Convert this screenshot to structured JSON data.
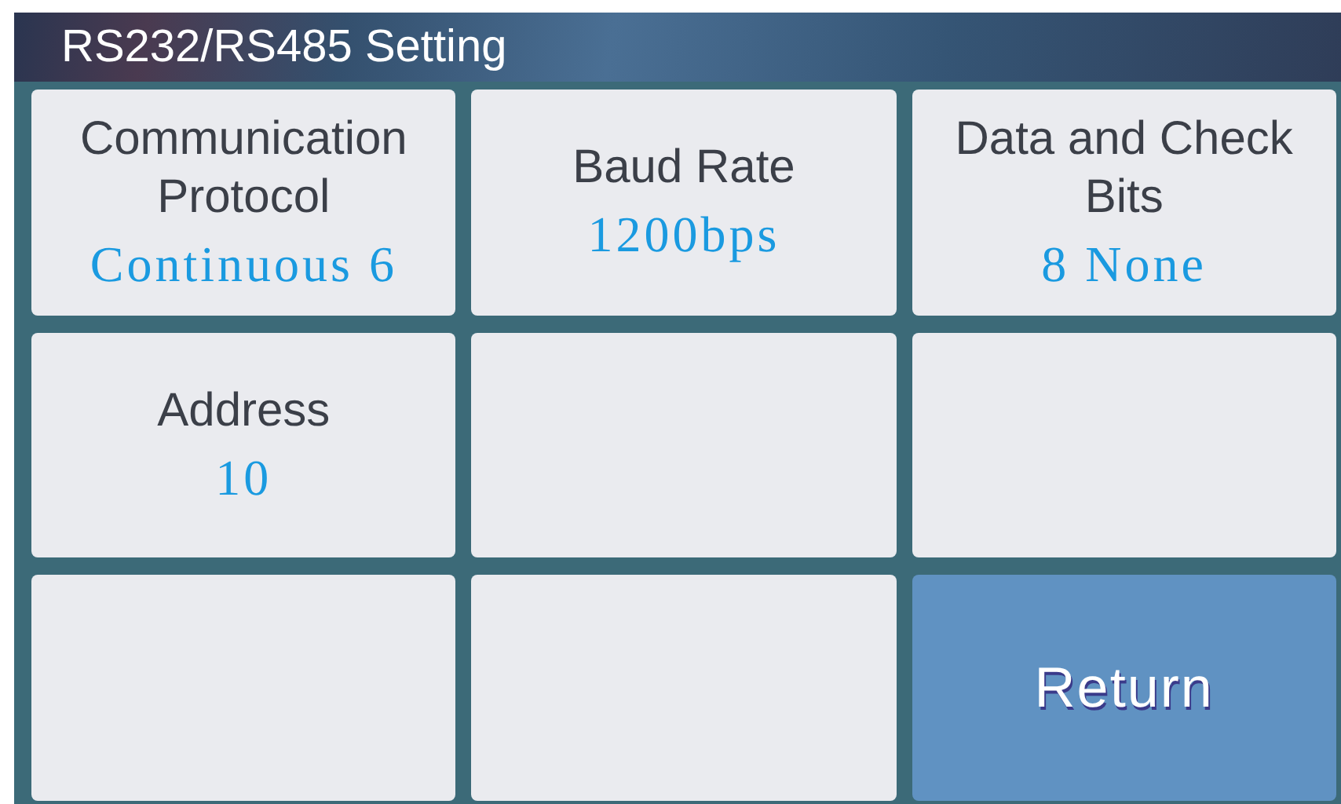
{
  "window": {
    "title": "RS232/RS485 Setting"
  },
  "tiles": [
    {
      "kind": "setting",
      "label": "Communication Protocol",
      "value": "Continuous 6"
    },
    {
      "kind": "setting",
      "label": "Baud Rate",
      "value": "1200bps"
    },
    {
      "kind": "setting",
      "label": "Data and Check Bits",
      "value": "8 None"
    },
    {
      "kind": "setting",
      "label": "Address",
      "value": "10"
    },
    {
      "kind": "empty"
    },
    {
      "kind": "empty"
    },
    {
      "kind": "empty"
    },
    {
      "kind": "empty"
    },
    {
      "kind": "button",
      "label": "Return"
    }
  ]
}
